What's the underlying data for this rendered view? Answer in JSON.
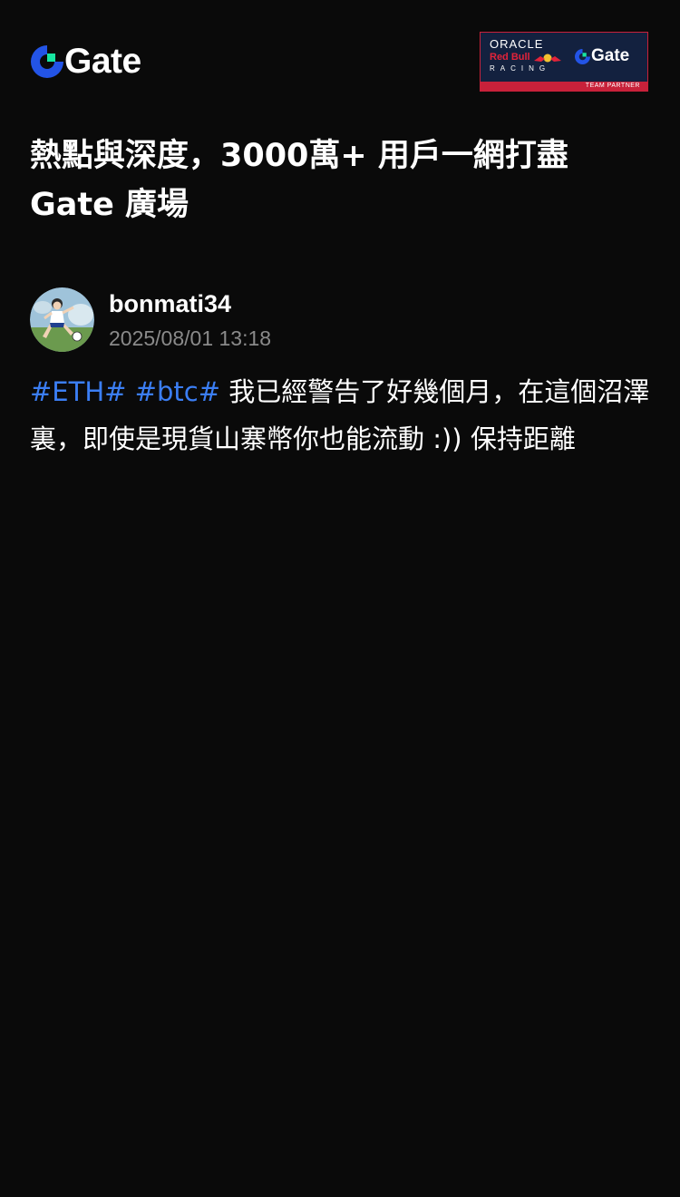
{
  "header": {
    "logo_text": "Gate",
    "partner_badge": {
      "oracle": "ORACLE",
      "red_bull": "Red Bull",
      "racing": "RACING",
      "gate": "Gate",
      "footer": "TEAM PARTNER"
    }
  },
  "headline": "熱點與深度，3000萬+ 用戶一網打盡 Gate 廣場",
  "post": {
    "author": {
      "username": "bonmati34",
      "timestamp": "2025/08/01 13:18"
    },
    "hashtags": [
      "#ETH#",
      "#btc#"
    ],
    "text": "我已經警告了好幾個月，在這個沼澤裏，即使是現貨山寨幣你也能流動 :)) 保持距離"
  },
  "colors": {
    "background": "#0a0a0a",
    "brand_blue": "#2354e6",
    "brand_green": "#17e6a1",
    "hashtag": "#3b7ef4",
    "timestamp": "#8a8a8a",
    "badge_navy": "#13213f",
    "badge_red": "#c8213a"
  }
}
